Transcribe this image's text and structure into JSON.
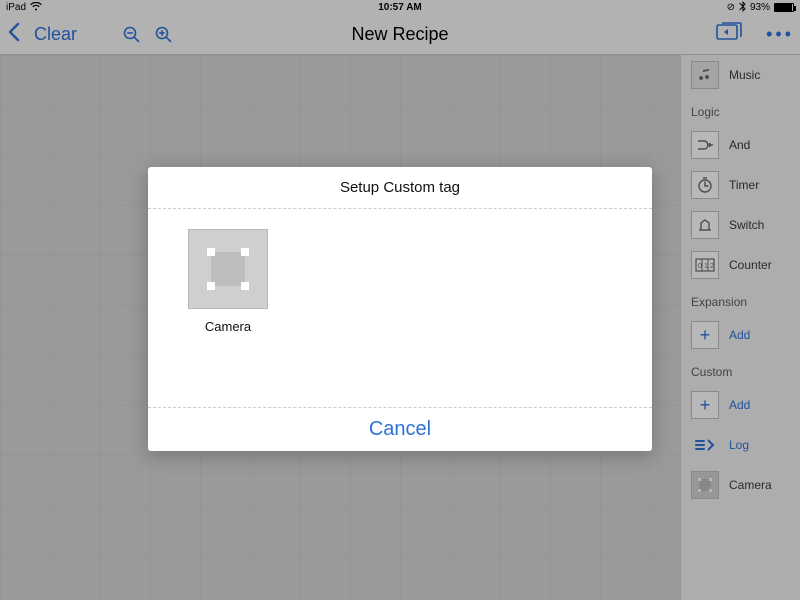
{
  "status_bar": {
    "device": "iPad",
    "time": "10:57 AM",
    "battery_percent": "93%"
  },
  "toolbar": {
    "clear_label": "Clear",
    "title": "New Recipe"
  },
  "sidebar": {
    "top_item": "Music",
    "sections": {
      "logic": {
        "label": "Logic",
        "items": [
          "And",
          "Timer",
          "Switch",
          "Counter"
        ]
      },
      "expansion": {
        "label": "Expansion",
        "add_label": "Add"
      },
      "custom": {
        "label": "Custom",
        "add_label": "Add",
        "log_label": "Log",
        "camera_label": "Camera"
      }
    }
  },
  "modal": {
    "title": "Setup Custom tag",
    "tile_label": "Camera",
    "cancel_label": "Cancel"
  }
}
